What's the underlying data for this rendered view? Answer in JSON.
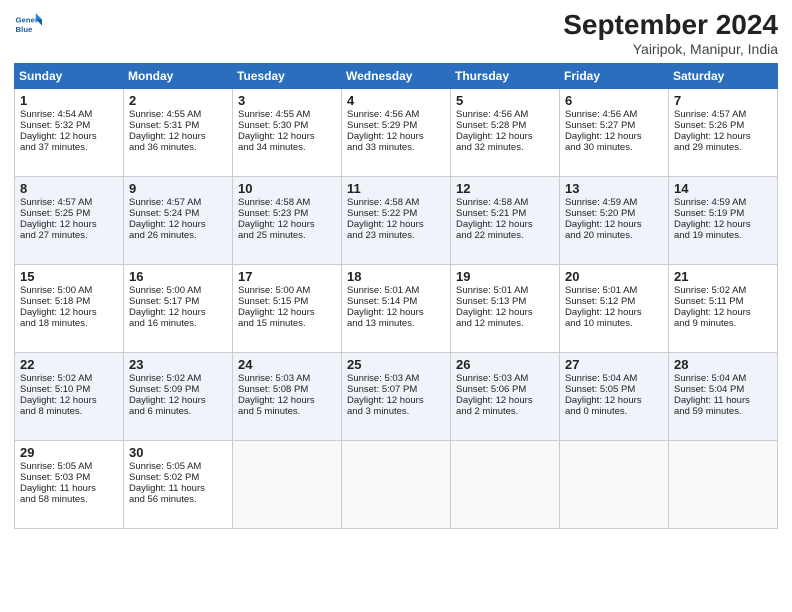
{
  "header": {
    "logo_line1": "General",
    "logo_line2": "Blue",
    "title": "September 2024",
    "subtitle": "Yairipok, Manipur, India"
  },
  "days_of_week": [
    "Sunday",
    "Monday",
    "Tuesday",
    "Wednesday",
    "Thursday",
    "Friday",
    "Saturday"
  ],
  "weeks": [
    [
      {
        "day": "1",
        "lines": [
          "Sunrise: 4:54 AM",
          "Sunset: 5:32 PM",
          "Daylight: 12 hours",
          "and 37 minutes."
        ]
      },
      {
        "day": "2",
        "lines": [
          "Sunrise: 4:55 AM",
          "Sunset: 5:31 PM",
          "Daylight: 12 hours",
          "and 36 minutes."
        ]
      },
      {
        "day": "3",
        "lines": [
          "Sunrise: 4:55 AM",
          "Sunset: 5:30 PM",
          "Daylight: 12 hours",
          "and 34 minutes."
        ]
      },
      {
        "day": "4",
        "lines": [
          "Sunrise: 4:56 AM",
          "Sunset: 5:29 PM",
          "Daylight: 12 hours",
          "and 33 minutes."
        ]
      },
      {
        "day": "5",
        "lines": [
          "Sunrise: 4:56 AM",
          "Sunset: 5:28 PM",
          "Daylight: 12 hours",
          "and 32 minutes."
        ]
      },
      {
        "day": "6",
        "lines": [
          "Sunrise: 4:56 AM",
          "Sunset: 5:27 PM",
          "Daylight: 12 hours",
          "and 30 minutes."
        ]
      },
      {
        "day": "7",
        "lines": [
          "Sunrise: 4:57 AM",
          "Sunset: 5:26 PM",
          "Daylight: 12 hours",
          "and 29 minutes."
        ]
      }
    ],
    [
      {
        "day": "8",
        "lines": [
          "Sunrise: 4:57 AM",
          "Sunset: 5:25 PM",
          "Daylight: 12 hours",
          "and 27 minutes."
        ]
      },
      {
        "day": "9",
        "lines": [
          "Sunrise: 4:57 AM",
          "Sunset: 5:24 PM",
          "Daylight: 12 hours",
          "and 26 minutes."
        ]
      },
      {
        "day": "10",
        "lines": [
          "Sunrise: 4:58 AM",
          "Sunset: 5:23 PM",
          "Daylight: 12 hours",
          "and 25 minutes."
        ]
      },
      {
        "day": "11",
        "lines": [
          "Sunrise: 4:58 AM",
          "Sunset: 5:22 PM",
          "Daylight: 12 hours",
          "and 23 minutes."
        ]
      },
      {
        "day": "12",
        "lines": [
          "Sunrise: 4:58 AM",
          "Sunset: 5:21 PM",
          "Daylight: 12 hours",
          "and 22 minutes."
        ]
      },
      {
        "day": "13",
        "lines": [
          "Sunrise: 4:59 AM",
          "Sunset: 5:20 PM",
          "Daylight: 12 hours",
          "and 20 minutes."
        ]
      },
      {
        "day": "14",
        "lines": [
          "Sunrise: 4:59 AM",
          "Sunset: 5:19 PM",
          "Daylight: 12 hours",
          "and 19 minutes."
        ]
      }
    ],
    [
      {
        "day": "15",
        "lines": [
          "Sunrise: 5:00 AM",
          "Sunset: 5:18 PM",
          "Daylight: 12 hours",
          "and 18 minutes."
        ]
      },
      {
        "day": "16",
        "lines": [
          "Sunrise: 5:00 AM",
          "Sunset: 5:17 PM",
          "Daylight: 12 hours",
          "and 16 minutes."
        ]
      },
      {
        "day": "17",
        "lines": [
          "Sunrise: 5:00 AM",
          "Sunset: 5:15 PM",
          "Daylight: 12 hours",
          "and 15 minutes."
        ]
      },
      {
        "day": "18",
        "lines": [
          "Sunrise: 5:01 AM",
          "Sunset: 5:14 PM",
          "Daylight: 12 hours",
          "and 13 minutes."
        ]
      },
      {
        "day": "19",
        "lines": [
          "Sunrise: 5:01 AM",
          "Sunset: 5:13 PM",
          "Daylight: 12 hours",
          "and 12 minutes."
        ]
      },
      {
        "day": "20",
        "lines": [
          "Sunrise: 5:01 AM",
          "Sunset: 5:12 PM",
          "Daylight: 12 hours",
          "and 10 minutes."
        ]
      },
      {
        "day": "21",
        "lines": [
          "Sunrise: 5:02 AM",
          "Sunset: 5:11 PM",
          "Daylight: 12 hours",
          "and 9 minutes."
        ]
      }
    ],
    [
      {
        "day": "22",
        "lines": [
          "Sunrise: 5:02 AM",
          "Sunset: 5:10 PM",
          "Daylight: 12 hours",
          "and 8 minutes."
        ]
      },
      {
        "day": "23",
        "lines": [
          "Sunrise: 5:02 AM",
          "Sunset: 5:09 PM",
          "Daylight: 12 hours",
          "and 6 minutes."
        ]
      },
      {
        "day": "24",
        "lines": [
          "Sunrise: 5:03 AM",
          "Sunset: 5:08 PM",
          "Daylight: 12 hours",
          "and 5 minutes."
        ]
      },
      {
        "day": "25",
        "lines": [
          "Sunrise: 5:03 AM",
          "Sunset: 5:07 PM",
          "Daylight: 12 hours",
          "and 3 minutes."
        ]
      },
      {
        "day": "26",
        "lines": [
          "Sunrise: 5:03 AM",
          "Sunset: 5:06 PM",
          "Daylight: 12 hours",
          "and 2 minutes."
        ]
      },
      {
        "day": "27",
        "lines": [
          "Sunrise: 5:04 AM",
          "Sunset: 5:05 PM",
          "Daylight: 12 hours",
          "and 0 minutes."
        ]
      },
      {
        "day": "28",
        "lines": [
          "Sunrise: 5:04 AM",
          "Sunset: 5:04 PM",
          "Daylight: 11 hours",
          "and 59 minutes."
        ]
      }
    ],
    [
      {
        "day": "29",
        "lines": [
          "Sunrise: 5:05 AM",
          "Sunset: 5:03 PM",
          "Daylight: 11 hours",
          "and 58 minutes."
        ]
      },
      {
        "day": "30",
        "lines": [
          "Sunrise: 5:05 AM",
          "Sunset: 5:02 PM",
          "Daylight: 11 hours",
          "and 56 minutes."
        ]
      },
      {
        "day": "",
        "lines": []
      },
      {
        "day": "",
        "lines": []
      },
      {
        "day": "",
        "lines": []
      },
      {
        "day": "",
        "lines": []
      },
      {
        "day": "",
        "lines": []
      }
    ]
  ]
}
